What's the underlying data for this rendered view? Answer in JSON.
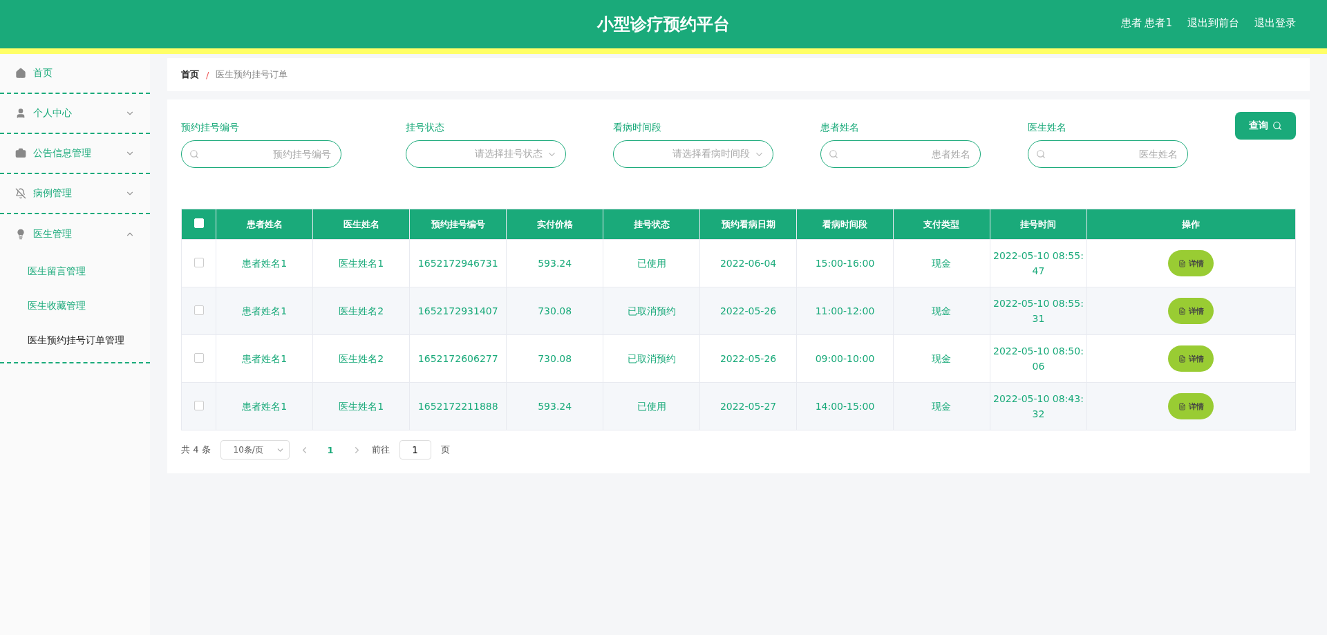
{
  "header": {
    "title": "小型诊疗预约平台",
    "links": [
      "患者 患者1",
      "退出到前台",
      "退出登录"
    ]
  },
  "sidebar": {
    "items": [
      {
        "label": "首页"
      },
      {
        "label": "个人中心",
        "expanded": false
      },
      {
        "label": "公告信息管理",
        "expanded": false
      },
      {
        "label": "病例管理",
        "expanded": false
      },
      {
        "label": "医生管理",
        "expanded": true,
        "children": [
          {
            "label": "医生留言管理",
            "selected": false
          },
          {
            "label": "医生收藏管理",
            "selected": false
          },
          {
            "label": "医生预约挂号订单管理",
            "selected": true
          }
        ]
      }
    ]
  },
  "breadcrumb": [
    "首页",
    "/",
    "医生预约挂号订单"
  ],
  "filters": [
    {
      "kind": "input",
      "label": "预约挂号编号",
      "placeholder": "预约挂号编号"
    },
    {
      "kind": "select",
      "label": "挂号状态",
      "placeholder": "请选择挂号状态"
    },
    {
      "kind": "select",
      "label": "看病时间段",
      "placeholder": "请选择看病时间段"
    },
    {
      "kind": "input",
      "label": "患者姓名",
      "placeholder": "患者姓名"
    },
    {
      "kind": "input",
      "label": "医生姓名",
      "placeholder": "医生姓名"
    }
  ],
  "search_button": "查询",
  "table": {
    "all_checked": false,
    "columns": [
      "患者姓名",
      "医生姓名",
      "预约挂号编号",
      "实付价格",
      "挂号状态",
      "预约看病日期",
      "看病时间段",
      "支付类型",
      "挂号时间",
      "操作"
    ],
    "rows": [
      {
        "checked": false,
        "cells": [
          "患者姓名1",
          "医生姓名1",
          "1652172946731",
          "593.24",
          "已使用",
          "2022-06-04",
          "15:00-16:00",
          "现金",
          "2022-05-10 08:55:47"
        ],
        "action": "详情"
      },
      {
        "checked": false,
        "cells": [
          "患者姓名1",
          "医生姓名2",
          "1652172931407",
          "730.08",
          "已取消预约",
          "2022-05-26",
          "11:00-12:00",
          "现金",
          "2022-05-10 08:55:31"
        ],
        "action": "详情"
      },
      {
        "checked": false,
        "cells": [
          "患者姓名1",
          "医生姓名2",
          "1652172606277",
          "730.08",
          "已取消预约",
          "2022-05-26",
          "09:00-10:00",
          "现金",
          "2022-05-10 08:50:06"
        ],
        "action": "详情"
      },
      {
        "checked": false,
        "cells": [
          "患者姓名1",
          "医生姓名1",
          "1652172211888",
          "593.24",
          "已使用",
          "2022-05-27",
          "14:00-15:00",
          "现金",
          "2022-05-10 08:43:32"
        ],
        "action": "详情"
      }
    ]
  },
  "pagination": {
    "total": "共 4 条",
    "page_size": "10条/页",
    "pages": [
      {
        "label": "1",
        "selected": true
      }
    ],
    "goto_label": "前往",
    "goto_value": "1",
    "goto_suffix": "页"
  }
}
